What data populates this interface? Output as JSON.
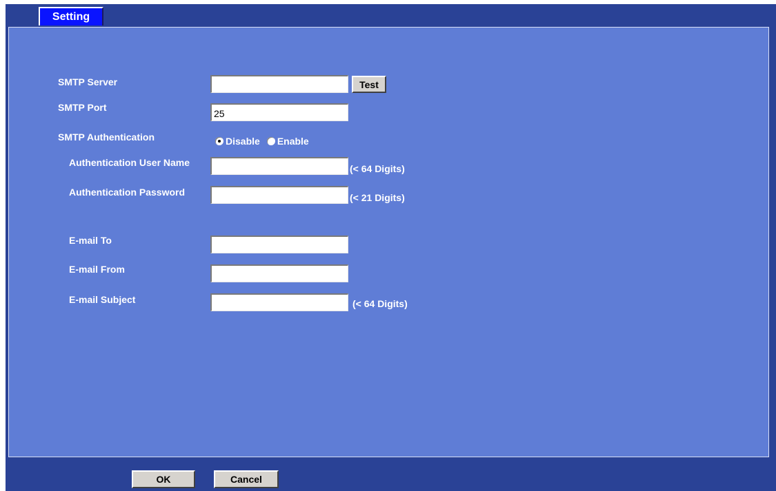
{
  "tab": {
    "label": "Setting"
  },
  "smtp": {
    "server_label": "SMTP Server",
    "server_value": "",
    "test_label": "Test",
    "port_label": "SMTP Port",
    "port_value": "25",
    "auth_label": "SMTP Authentication",
    "auth_options": [
      "Disable",
      "Enable"
    ],
    "auth_selected": "Disable",
    "user_label": "Authentication User Name",
    "user_value": "",
    "user_hint": "(< 64 Digits)",
    "pass_label": "Authentication Password",
    "pass_value": "",
    "pass_hint": "(< 21 Digits)"
  },
  "email": {
    "to_label": "E-mail To",
    "to_value": "",
    "from_label": "E-mail From",
    "from_value": "",
    "subject_label": "E-mail Subject",
    "subject_value": "",
    "subject_hint": "(< 64 Digits)"
  },
  "footer": {
    "ok_label": "OK",
    "cancel_label": "Cancel"
  }
}
